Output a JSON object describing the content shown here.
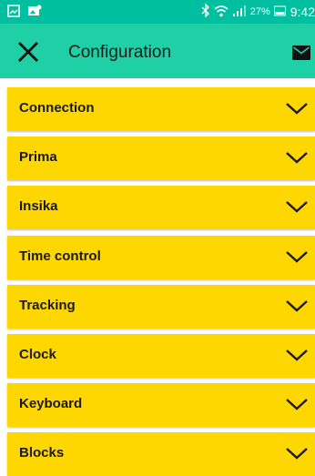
{
  "status_bar": {
    "battery": "27%",
    "time": "9:42",
    "icons": [
      "image-icon",
      "photo-icon",
      "bluetooth-icon",
      "wifi-icon",
      "signal-icon",
      "battery-icon"
    ]
  },
  "app_bar": {
    "title": "Configuration",
    "close_icon": "close-icon",
    "mail_icon": "mail-icon",
    "color": "#1fcfa6"
  },
  "sections": [
    {
      "label": "Connection"
    },
    {
      "label": "Prima"
    },
    {
      "label": "Insika"
    },
    {
      "label": "Time control"
    },
    {
      "label": "Tracking"
    },
    {
      "label": "Clock"
    },
    {
      "label": "Keyboard"
    },
    {
      "label": "Blocks"
    }
  ],
  "colors": {
    "section_background": "#ffd700",
    "status_bar": "#00bfa0"
  }
}
